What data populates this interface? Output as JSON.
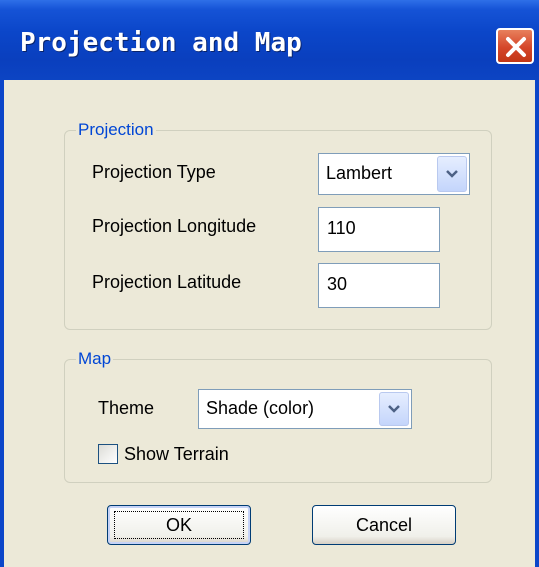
{
  "window": {
    "title": "Projection and Map",
    "close_icon": "close-icon",
    "colors": {
      "titlebar": "#0b46c9",
      "close": "#d5462a",
      "face": "#ECE9D8",
      "legend": "#0046d5"
    }
  },
  "projection": {
    "legend": "Projection",
    "type_label": "Projection Type",
    "type_value": "Lambert",
    "longitude_label": "Projection Longitude",
    "longitude_value": "110",
    "latitude_label": "Projection Latitude",
    "latitude_value": "30"
  },
  "map": {
    "legend": "Map",
    "theme_label": "Theme",
    "theme_value": "Shade (color)",
    "show_terrain_label": "Show Terrain",
    "show_terrain_checked": false
  },
  "buttons": {
    "ok": "OK",
    "cancel": "Cancel"
  }
}
